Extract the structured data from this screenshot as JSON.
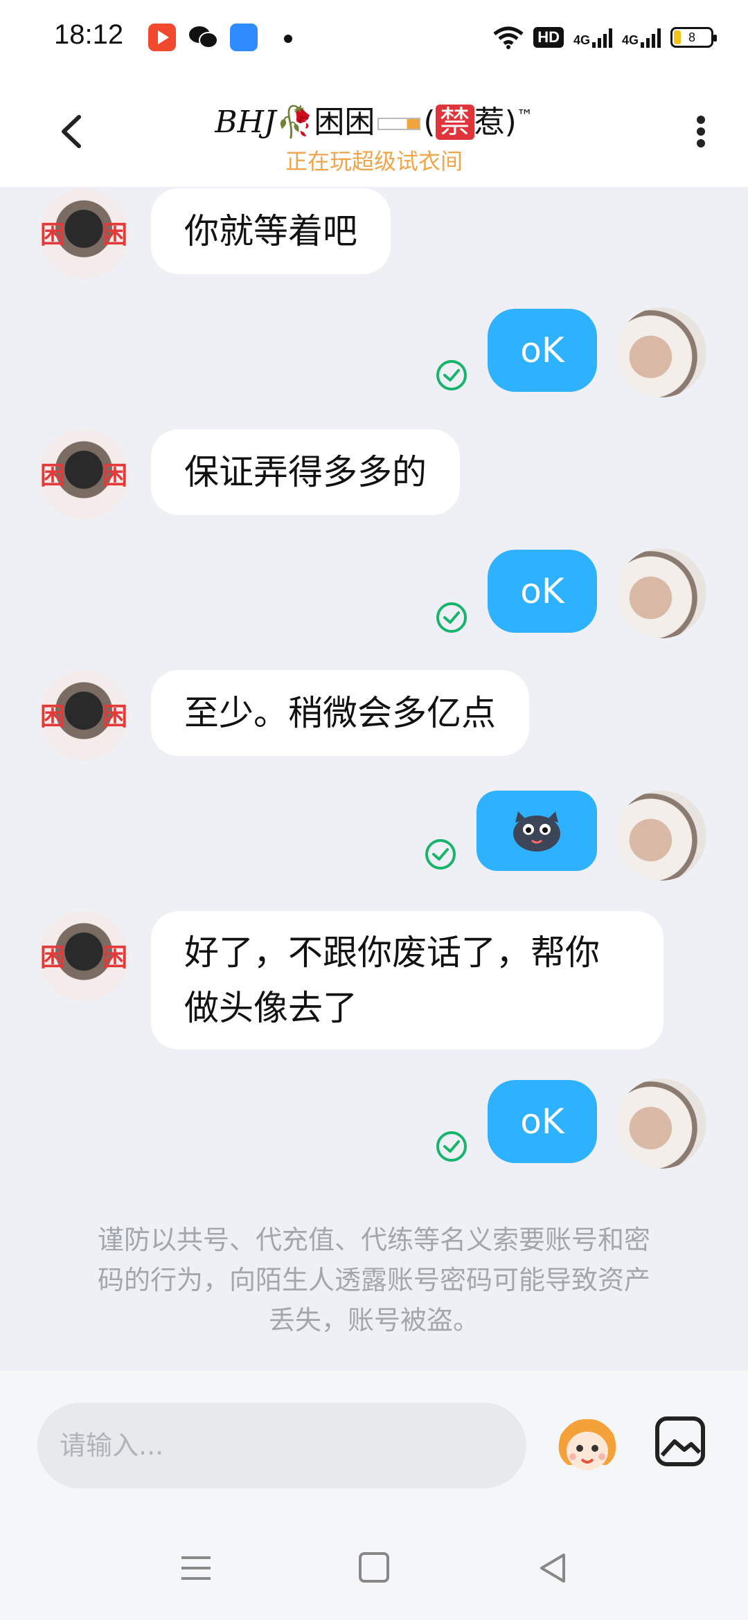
{
  "status_bar": {
    "time": "18:12",
    "hd_label": "HD",
    "network_1": "4G",
    "network_2": "4G",
    "battery": "8",
    "icons": [
      "video-app-icon",
      "wechat-icon",
      "files-app-icon",
      "notification-dot",
      "wifi-icon",
      "signal-icon",
      "battery-icon"
    ]
  },
  "header": {
    "title_prefix": "BHJ",
    "title_name": "困困",
    "title_ban": "禁",
    "title_suffix": "惹",
    "title_tm": "™",
    "subtitle": "正在玩超级试衣间"
  },
  "messages": [
    {
      "side": "in",
      "text": "你就等着吧"
    },
    {
      "side": "out",
      "text": "oK",
      "status": "sent"
    },
    {
      "side": "in",
      "text": "保证弄得多多的"
    },
    {
      "side": "out",
      "text": "oK",
      "status": "sent"
    },
    {
      "side": "in",
      "text": "至少。稍微会多亿点"
    },
    {
      "side": "out",
      "type": "sticker",
      "status": "sent"
    },
    {
      "side": "in",
      "text_line1": "好了，不跟你废话了，帮你",
      "text_line2": "做头像去了"
    },
    {
      "side": "out",
      "text": "oK",
      "status": "sent"
    }
  ],
  "notice": {
    "line1": "谨防以共号、代充值、代练等名义索要账号和密",
    "line2": "码的行为，向陌生人透露账号密码可能导致资产",
    "line3": "丢失，账号被盗。"
  },
  "input": {
    "placeholder": "请输入..."
  },
  "colors": {
    "accent": "#2eb2ff",
    "background": "#eef0f5",
    "subtitle": "#f0a54a",
    "check": "#19b46b"
  },
  "avatar_marks": {
    "left_mark": "困",
    "right_mark": "困"
  }
}
